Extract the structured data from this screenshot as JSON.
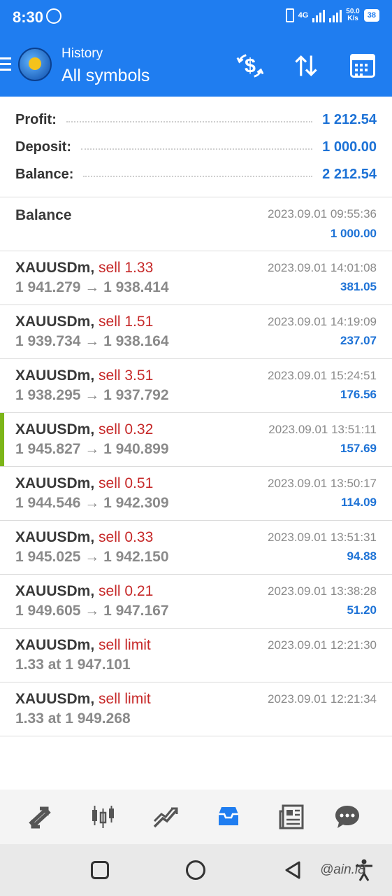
{
  "status_bar": {
    "time": "8:30",
    "network_speed": "50.0",
    "network_unit": "K/s",
    "network_type": "4G",
    "battery": "38"
  },
  "app_bar": {
    "subtitle": "History",
    "title": "All symbols"
  },
  "summary": {
    "profit_label": "Profit:",
    "profit_value": "1 212.54",
    "deposit_label": "Deposit:",
    "deposit_value": "1 000.00",
    "balance_label": "Balance:",
    "balance_value": "2 212.54"
  },
  "balance_entry": {
    "label": "Balance",
    "time": "2023.09.01 09:55:36",
    "amount": "1 000.00"
  },
  "deals": [
    {
      "symbol": "XAUUSDm,",
      "side": "sell 1.33",
      "prices": "1 941.279 → 1 938.414",
      "time": "2023.09.01 14:01:08",
      "profit": "381.05"
    },
    {
      "symbol": "XAUUSDm,",
      "side": "sell 1.51",
      "prices": "1 939.734 → 1 938.164",
      "time": "2023.09.01 14:19:09",
      "profit": "237.07"
    },
    {
      "symbol": "XAUUSDm,",
      "side": "sell 3.51",
      "prices": "1 938.295 → 1 937.792",
      "time": "2023.09.01 15:24:51",
      "profit": "176.56"
    },
    {
      "symbol": "XAUUSDm,",
      "side": "sell 0.32",
      "prices": "1 945.827 → 1 940.899",
      "time": "2023.09.01 13:51:11",
      "profit": "157.69"
    },
    {
      "symbol": "XAUUSDm,",
      "side": "sell 0.51",
      "prices": "1 944.546 → 1 942.309",
      "time": "2023.09.01 13:50:17",
      "profit": "114.09"
    },
    {
      "symbol": "XAUUSDm,",
      "side": "sell 0.33",
      "prices": "1 945.025 → 1 942.150",
      "time": "2023.09.01 13:51:31",
      "profit": "94.88"
    },
    {
      "symbol": "XAUUSDm,",
      "side": "sell 0.21",
      "prices": "1 949.605 → 1 947.167",
      "time": "2023.09.01 13:38:28",
      "profit": "51.20"
    }
  ],
  "orders": [
    {
      "symbol": "XAUUSDm,",
      "side": "sell limit",
      "detail": "1.33 at 1 947.101",
      "time": "2023.09.01 12:21:30"
    },
    {
      "symbol": "XAUUSDm,",
      "side": "sell limit",
      "detail": "1.33 at 1 949.268",
      "time": "2023.09.01 12:21:34"
    }
  ],
  "watermark": "@ain.i8",
  "colors": {
    "primary": "#1f7df0",
    "profit_blue": "#1d72d6",
    "sell_red": "#c62828",
    "marker_green": "#7cb518"
  },
  "icons": {
    "appbar": [
      "menu-icon",
      "app-logo-icon",
      "dollar-exchange-icon",
      "sort-icon",
      "calendar-icon"
    ],
    "bottom_nav": [
      "quotes-icon",
      "chart-candles-icon",
      "trade-icon",
      "history-icon",
      "news-icon",
      "chat-icon"
    ]
  }
}
